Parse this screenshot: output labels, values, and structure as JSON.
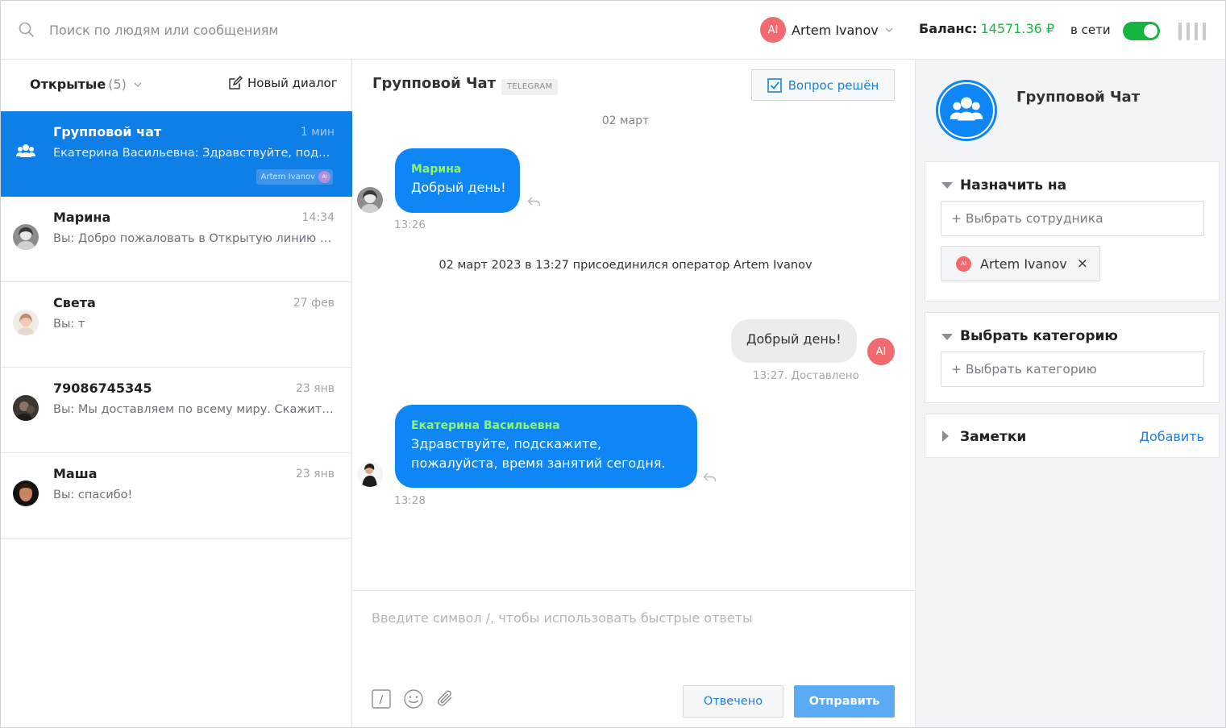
{
  "topbar": {
    "search_placeholder": "Поиск по людям или сообщениям",
    "user_initials": "AI",
    "user_name": "Artem Ivanov",
    "balance_label": "Баланс:",
    "balance_value": "14571.36 ₽",
    "online_label": "в сети",
    "online_enabled": true
  },
  "sidebar": {
    "filter_label": "Открытые",
    "filter_count": "(5)",
    "new_dialog_label": "Новый диалог",
    "dialogs": [
      {
        "name": "Групповой чат",
        "time": "1 мин",
        "preview": "Екатерина Васильевна: Здравствуйте, подскажите, пожалуйста, время занятий сегодня.",
        "tag": "Artem Ivanov",
        "tag_initials": "AI",
        "active": true
      },
      {
        "name": "Марина",
        "time": "14:34",
        "preview_prefix": "Вы:",
        "preview": "Добро пожаловать в Открытую линию компании",
        "active": false
      },
      {
        "name": "Света",
        "time": "27 фев",
        "preview_prefix": "Вы:",
        "preview": "т",
        "active": false
      },
      {
        "name": "79086745345",
        "time": "23 янв",
        "preview_prefix": "Вы:",
        "preview": "Мы доставляем по всему миру. Скажите, пожалуйста",
        "active": false
      },
      {
        "name": "Маша",
        "time": "23 янв",
        "preview_prefix": "Вы:",
        "preview": "спасибо!",
        "active": false
      }
    ]
  },
  "chat": {
    "title": "Групповой Чат",
    "channel_badge": "TELEGRAM",
    "resolved_label": "Вопрос решён",
    "date_separator": "02 март",
    "messages": [
      {
        "author": "Марина",
        "text": "Добрый день!",
        "time": "13:26"
      },
      {
        "system": "02 март 2023 в 13:27 присоединился оператор Artem Ivanov"
      },
      {
        "outgoing_text": "Добрый день!",
        "status": "13:27. Доставлено",
        "initials": "AI"
      },
      {
        "author": "Екатерина Васильевна",
        "line1": "Здравствуйте, подскажите,",
        "line2": "пожалуйста, время занятий сегодня.",
        "time": "13:28"
      }
    ],
    "composer_placeholder": "Введите символ /, чтобы использовать быстрые ответы",
    "quick_reply_glyph": "/",
    "answered_label": "Отвечено",
    "send_label": "Отправить"
  },
  "details": {
    "title": "Групповой Чат",
    "assign_title": "Назначить на",
    "assign_placeholder": "+ Выбрать сотрудника",
    "assignee_initials": "AI",
    "assignee_name": "Artem Ivanov",
    "assignee_remove": "×",
    "category_title": "Выбрать категорию",
    "category_placeholder": "+ Выбрать категорию",
    "notes_title": "Заметки",
    "notes_add": "Добавить"
  },
  "colors": {
    "accent": "#0e7fe6",
    "bubble_in": "#0e86f5",
    "author_name": "#8ff56b",
    "balance": "#22b14c",
    "toggle_on": "#15b53f",
    "avatar_ai": "#f06a6f"
  },
  "icons": {
    "search": "search-icon",
    "chevron": "chevron-down-icon",
    "menu": "menu-bars-icon",
    "new_dialog": "edit-icon",
    "resolved": "checkbox-checked-icon",
    "reply": "reply-arrow-icon",
    "quick_reply": "slash-icon",
    "emoji": "smile-icon",
    "attach": "paperclip-icon",
    "group": "group-people-icon"
  }
}
